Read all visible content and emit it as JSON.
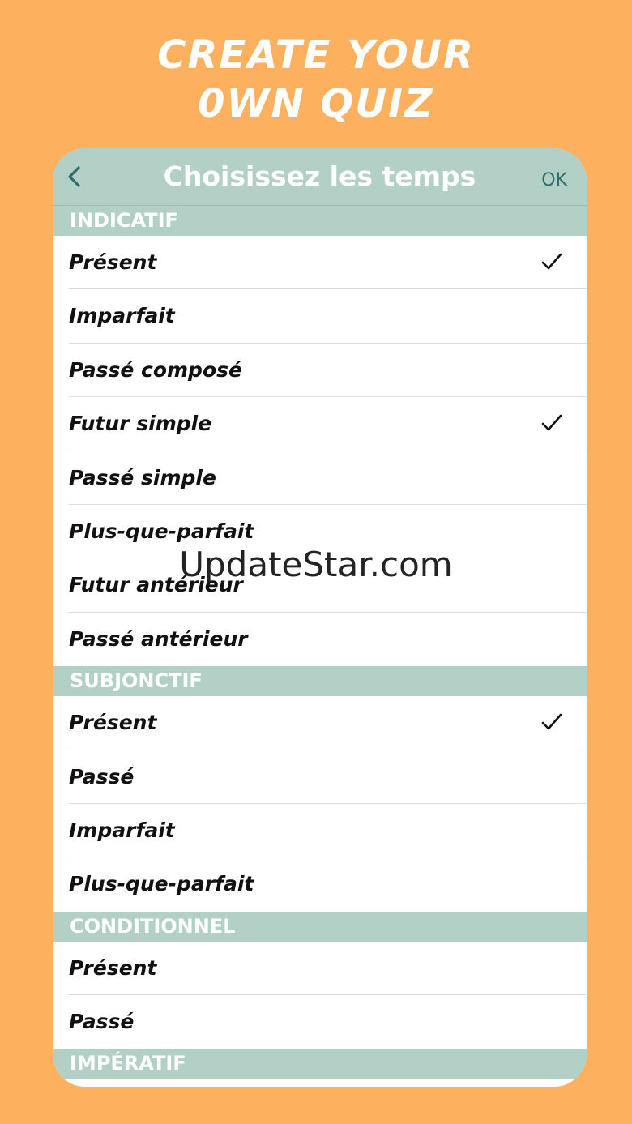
{
  "promo": {
    "line1": "CREATE YOUR",
    "line2": "0WN QUIZ"
  },
  "navbar": {
    "title": "Choisissez les temps",
    "ok_label": "OK"
  },
  "sections": [
    {
      "title": "INDICATIF",
      "items": [
        {
          "label": "Présent",
          "checked": true
        },
        {
          "label": "Imparfait",
          "checked": false
        },
        {
          "label": "Passé composé",
          "checked": false
        },
        {
          "label": "Futur simple",
          "checked": true
        },
        {
          "label": "Passé simple",
          "checked": false
        },
        {
          "label": "Plus-que-parfait",
          "checked": false
        },
        {
          "label": "Futur antérieur",
          "checked": false
        },
        {
          "label": "Passé antérieur",
          "checked": false
        }
      ]
    },
    {
      "title": "SUBJONCTIF",
      "items": [
        {
          "label": "Présent",
          "checked": true
        },
        {
          "label": "Passé",
          "checked": false
        },
        {
          "label": "Imparfait",
          "checked": false
        },
        {
          "label": "Plus-que-parfait",
          "checked": false
        }
      ]
    },
    {
      "title": "CONDITIONNEL",
      "items": [
        {
          "label": "Présent",
          "checked": false
        },
        {
          "label": "Passé",
          "checked": false
        }
      ]
    },
    {
      "title": "IMPÉRATIF",
      "items": []
    }
  ],
  "watermark": "UpdateStar.com",
  "colors": {
    "background": "#FDB05E",
    "header": "#B2D0C6",
    "accent": "#2e6e6a"
  }
}
